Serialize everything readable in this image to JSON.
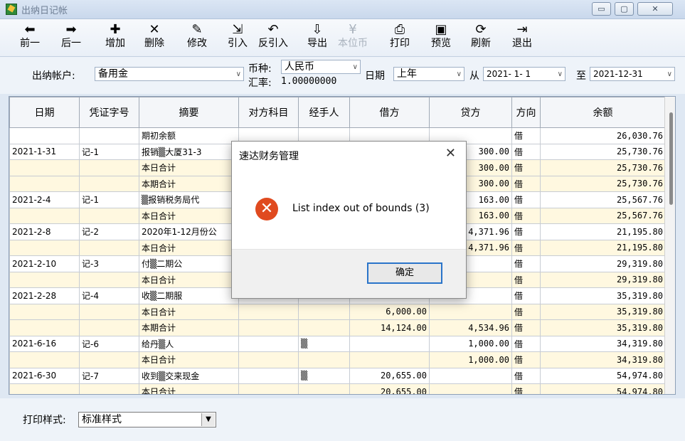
{
  "window": {
    "title": "出纳日记帐"
  },
  "toolbar": [
    {
      "label": "前一",
      "icon": "arrow-left-icon",
      "glyph": "⬅",
      "disabled": false
    },
    {
      "label": "后一",
      "icon": "arrow-right-icon",
      "glyph": "➡",
      "disabled": false
    },
    {
      "label": "增加",
      "icon": "add-icon",
      "glyph": "✚",
      "disabled": false
    },
    {
      "label": "删除",
      "icon": "delete-icon",
      "glyph": "✕",
      "disabled": false
    },
    {
      "label": "修改",
      "icon": "edit-icon",
      "glyph": "✎",
      "disabled": false
    },
    {
      "label": "引入",
      "icon": "import-icon",
      "glyph": "⇲",
      "disabled": false
    },
    {
      "label": "反引入",
      "icon": "undo-icon",
      "glyph": "↶",
      "disabled": false
    },
    {
      "label": "导出",
      "icon": "export-icon",
      "glyph": "⇩",
      "disabled": false
    },
    {
      "label": "本位币",
      "icon": "currency-icon",
      "glyph": "¥",
      "disabled": true
    },
    {
      "label": "打印",
      "icon": "print-icon",
      "glyph": "⎙",
      "disabled": false
    },
    {
      "label": "预览",
      "icon": "preview-icon",
      "glyph": "▣",
      "disabled": false
    },
    {
      "label": "刷新",
      "icon": "refresh-icon",
      "glyph": "⟳",
      "disabled": false
    },
    {
      "label": "退出",
      "icon": "exit-icon",
      "glyph": "⇥",
      "disabled": false
    }
  ],
  "filters": {
    "account_label": "出纳帐户:",
    "account_value": "备用金",
    "currency_label": "币种:",
    "currency_value": "人民币",
    "rate_label": "汇率:",
    "rate_value": "1.00000000",
    "date_label": "日期",
    "date_value": "上年",
    "from_label": "从",
    "from_value": "2021- 1- 1",
    "to_label": "至",
    "to_value": "2021-12-31"
  },
  "table": {
    "headers": [
      "日期",
      "凭证字号",
      "摘要",
      "对方科目",
      "经手人",
      "借方",
      "贷方",
      "方向",
      "余额"
    ],
    "rows": [
      {
        "alt": false,
        "cells": [
          "",
          "",
          "期初余额",
          "",
          "",
          "",
          "",
          "借",
          "26,030.76"
        ]
      },
      {
        "alt": false,
        "cells": [
          "2021-1-31",
          "记-1",
          "报销▒大厦31-3",
          "",
          "",
          "",
          "300.00",
          "借",
          "25,730.76"
        ]
      },
      {
        "alt": true,
        "cells": [
          "",
          "",
          "本日合计",
          "",
          "",
          "",
          "300.00",
          "借",
          "25,730.76"
        ]
      },
      {
        "alt": true,
        "cells": [
          "",
          "",
          "本期合计",
          "",
          "",
          "",
          "300.00",
          "借",
          "25,730.76"
        ]
      },
      {
        "alt": false,
        "cells": [
          "2021-2-4",
          "记-1",
          "▒报销税务局代",
          "",
          "",
          "",
          "163.00",
          "借",
          "25,567.76"
        ]
      },
      {
        "alt": true,
        "cells": [
          "",
          "",
          "本日合计",
          "",
          "",
          "",
          "163.00",
          "借",
          "25,567.76"
        ]
      },
      {
        "alt": false,
        "cells": [
          "2021-2-8",
          "记-2",
          "2020年1-12月份公",
          "",
          "",
          "",
          "4,371.96",
          "借",
          "21,195.80"
        ]
      },
      {
        "alt": true,
        "cells": [
          "",
          "",
          "本日合计",
          "",
          "",
          "",
          "4,371.96",
          "借",
          "21,195.80"
        ]
      },
      {
        "alt": false,
        "cells": [
          "2021-2-10",
          "记-3",
          "付▒二期公",
          "",
          "",
          "",
          "",
          "借",
          "29,319.80"
        ]
      },
      {
        "alt": true,
        "cells": [
          "",
          "",
          "本日合计",
          "",
          "",
          "",
          "",
          "借",
          "29,319.80"
        ]
      },
      {
        "alt": false,
        "cells": [
          "2021-2-28",
          "记-4",
          "收▒二期服",
          "",
          "",
          "",
          "",
          "借",
          "35,319.80"
        ]
      },
      {
        "alt": true,
        "cells": [
          "",
          "",
          "本日合计",
          "",
          "",
          "6,000.00",
          "",
          "借",
          "35,319.80"
        ]
      },
      {
        "alt": true,
        "cells": [
          "",
          "",
          "本期合计",
          "",
          "",
          "14,124.00",
          "4,534.96",
          "借",
          "35,319.80"
        ]
      },
      {
        "alt": false,
        "cells": [
          "2021-6-16",
          "记-6",
          "给丹▒人",
          "",
          "▒",
          "",
          "1,000.00",
          "借",
          "34,319.80"
        ]
      },
      {
        "alt": true,
        "cells": [
          "",
          "",
          "本日合计",
          "",
          "",
          "",
          "1,000.00",
          "借",
          "34,319.80"
        ]
      },
      {
        "alt": false,
        "cells": [
          "2021-6-30",
          "记-7",
          "收到▒交来现金",
          "",
          "▒",
          "20,655.00",
          "",
          "借",
          "54,974.80"
        ]
      },
      {
        "alt": true,
        "cells": [
          "",
          "",
          "本日合计",
          "",
          "",
          "20,655.00",
          "",
          "借",
          "54,974.80"
        ]
      }
    ]
  },
  "bottom": {
    "print_style_label": "打印样式:",
    "print_style_value": "标准样式"
  },
  "dialog": {
    "title": "速达财务管理",
    "message": "List index out of bounds (3)",
    "ok_label": "确定",
    "close_glyph": "✕",
    "error_glyph": "✕"
  }
}
